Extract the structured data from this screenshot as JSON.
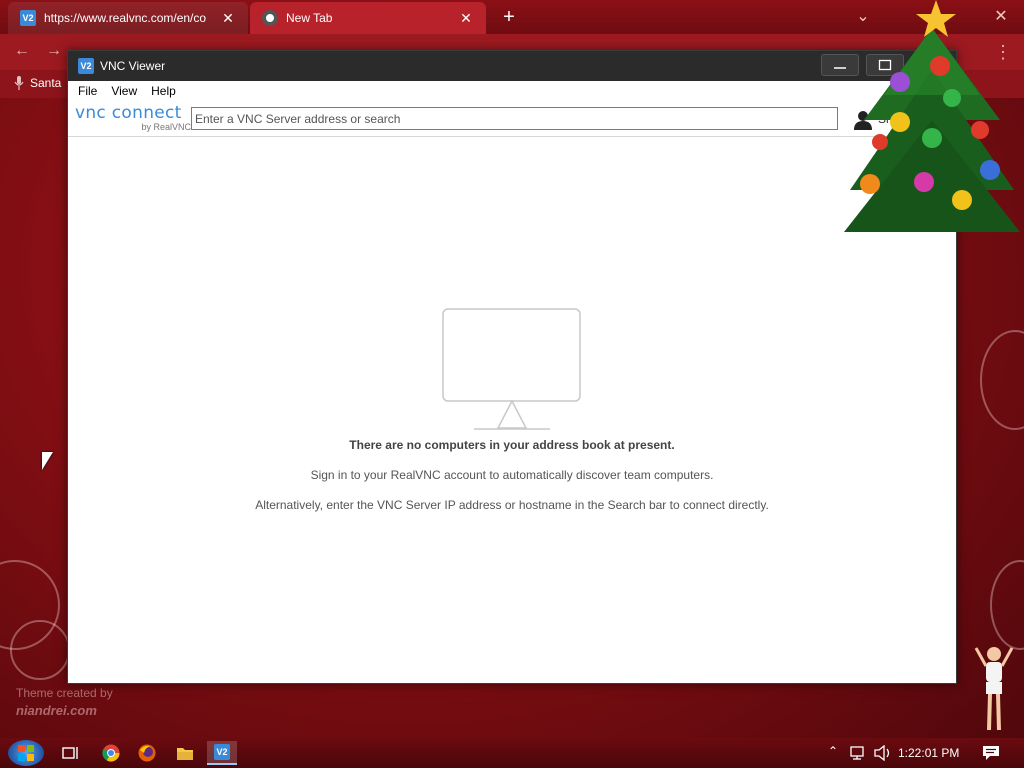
{
  "browser": {
    "tabs": [
      {
        "title": "https://www.realvnc.com/en/co",
        "favicon": "vnc-icon"
      },
      {
        "title": "New Tab",
        "favicon": "chrome-icon"
      }
    ],
    "new_tab_symbol": "+",
    "bookmark_label": "Santa"
  },
  "window": {
    "title": "VNC Viewer",
    "menu": [
      "File",
      "View",
      "Help"
    ],
    "brand": {
      "name": "vnc connect",
      "sub": "by RealVNC"
    },
    "search": {
      "placeholder": "Enter a VNC Server address or search",
      "value": ""
    },
    "signin_label": "Si"
  },
  "empty_state": {
    "heading": "There are no computers in your address book at present.",
    "line1": "Sign in to your RealVNC account to automatically discover team computers.",
    "line2": "Alternatively, enter the VNC Server IP address or hostname in the Search bar to connect directly."
  },
  "desktop": {
    "credit_line1": "Theme created by",
    "credit_line2": "niandrei.com"
  },
  "taskbar": {
    "clock": "1:22:01 PM"
  },
  "colors": {
    "accent": "#3b8ad9",
    "titlebar": "#2b2b2b",
    "desktop": "#8a1016"
  }
}
